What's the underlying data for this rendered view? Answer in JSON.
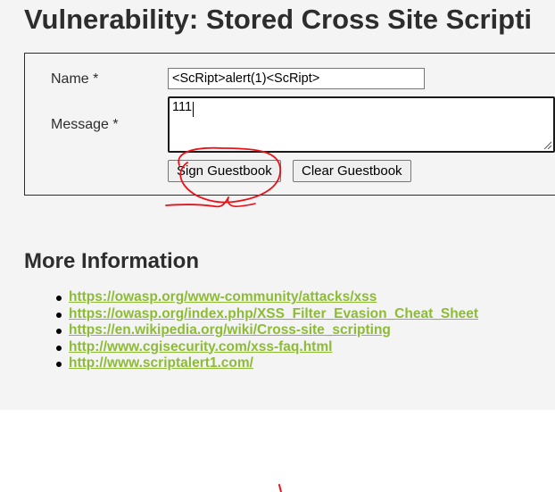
{
  "page": {
    "title": "Vulnerability: Stored Cross Site Scripti"
  },
  "form": {
    "name_label": "Name *",
    "name_value": "<ScRipt>alert(1)<ScRipt>",
    "message_label": "Message *",
    "message_value": "111",
    "sign_button": "Sign Guestbook",
    "clear_button": "Clear Guestbook"
  },
  "more_info": {
    "heading": "More Information",
    "links": [
      "https://owasp.org/www-community/attacks/xss",
      "https://owasp.org/index.php/XSS_Filter_Evasion_Cheat_Sheet",
      "https://en.wikipedia.org/wiki/Cross-site_scripting",
      "http://www.cgisecurity.com/xss-faq.html",
      "http://www.scriptalert1.com/"
    ]
  },
  "colors": {
    "link": "#8dbb36",
    "background": "#f4f4f4",
    "annotation": "#e8121a"
  },
  "annotation": {
    "icon": "red-hand-drawn-circle-icon"
  }
}
